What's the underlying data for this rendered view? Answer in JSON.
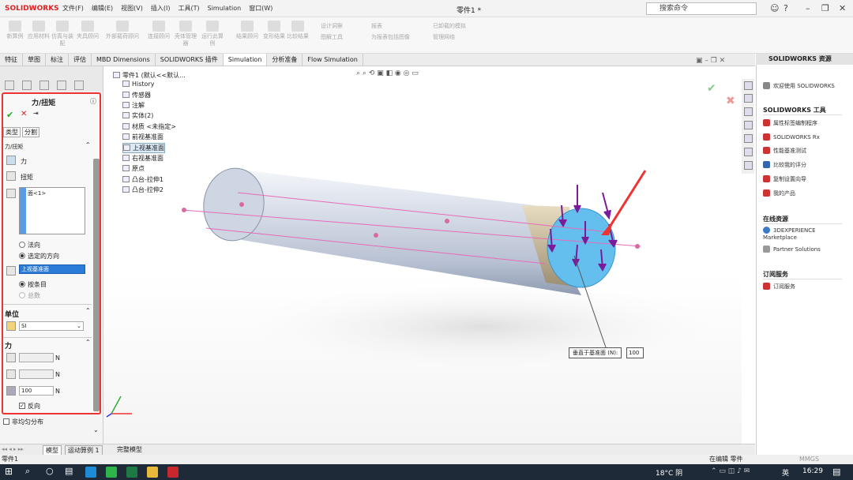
{
  "app": {
    "logo": "SOLIDWORKS",
    "doc_title": "零件1 *"
  },
  "menu": [
    "文件(F)",
    "编辑(E)",
    "视图(V)",
    "插入(I)",
    "工具(T)",
    "Simulation",
    "窗口(W)"
  ],
  "search": {
    "placeholder": "搜索命令"
  },
  "ribbon": {
    "buttons": [
      "新算例",
      "应用材料",
      "仿真与装配",
      "夹具顾问",
      "外部载荷顾问",
      "连接顾问",
      "壳体管理器",
      "运行此算例",
      "结果顾问",
      "变形结果",
      "比较结果"
    ],
    "small": [
      "设计洞察",
      "图解工具",
      "报表",
      "为报表包括图像",
      "已卸载的模拟",
      "管理网络"
    ]
  },
  "tabs": [
    "特征",
    "草图",
    "标注",
    "评估",
    "MBD Dimensions",
    "SOLIDWORKS 插件",
    "Simulation",
    "分析准备",
    "Flow Simulation"
  ],
  "active_tab": "Simulation",
  "property_manager": {
    "title": "力/扭矩",
    "subtabs": [
      "类型",
      "分割"
    ],
    "section_force": "力/扭矩",
    "opt_force": "力",
    "opt_torque": "扭矩",
    "selection": "面<1>",
    "radio_normal": "法向",
    "radio_selected_dir": "选定的方向",
    "direction_ref": "上视基准面",
    "radio_per_item": "按条目",
    "radio_total": "总数",
    "section_units": "单位",
    "unit": "SI",
    "section_force2": "力",
    "unit_n": "N",
    "value_3": "100",
    "reverse": "反向",
    "nonuniform": "非均匀分布"
  },
  "tree": {
    "root": "零件1 (默认<<默认...",
    "items": [
      "History",
      "传感器",
      "注解",
      "实体(2)",
      "材质 <未指定>",
      "前视基准面",
      "上视基准面",
      "右视基准面",
      "原点",
      "凸台-拉伸1",
      "凸台-拉伸2"
    ]
  },
  "annotation": {
    "label": "垂直于基准面 (N):",
    "value": "100"
  },
  "right_panel": {
    "title": "SOLIDWORKS 资源",
    "welcome": "欢迎使用 SOLIDWORKS",
    "tools_title": "SOLIDWORKS 工具",
    "tools": [
      "属性标签编制程序",
      "SOLIDWORKS Rx",
      "性能基准测试",
      "比较我的评分",
      "复制设置向导",
      "我的产品"
    ],
    "online_title": "在线资源",
    "online": [
      "3DEXPERIENCE Marketplace",
      "Partner Solutions"
    ],
    "sub_title": "订阅服务",
    "sub": [
      "订阅服务"
    ]
  },
  "bottom_tabs": [
    "模型",
    "运动算例 1",
    "完整模型"
  ],
  "status": {
    "left": "零件1",
    "editing": "在编辑 零件",
    "units": "MMGS"
  },
  "taskbar": {
    "weather": "18°C 阴",
    "ime": "英",
    "time": "16:29"
  }
}
